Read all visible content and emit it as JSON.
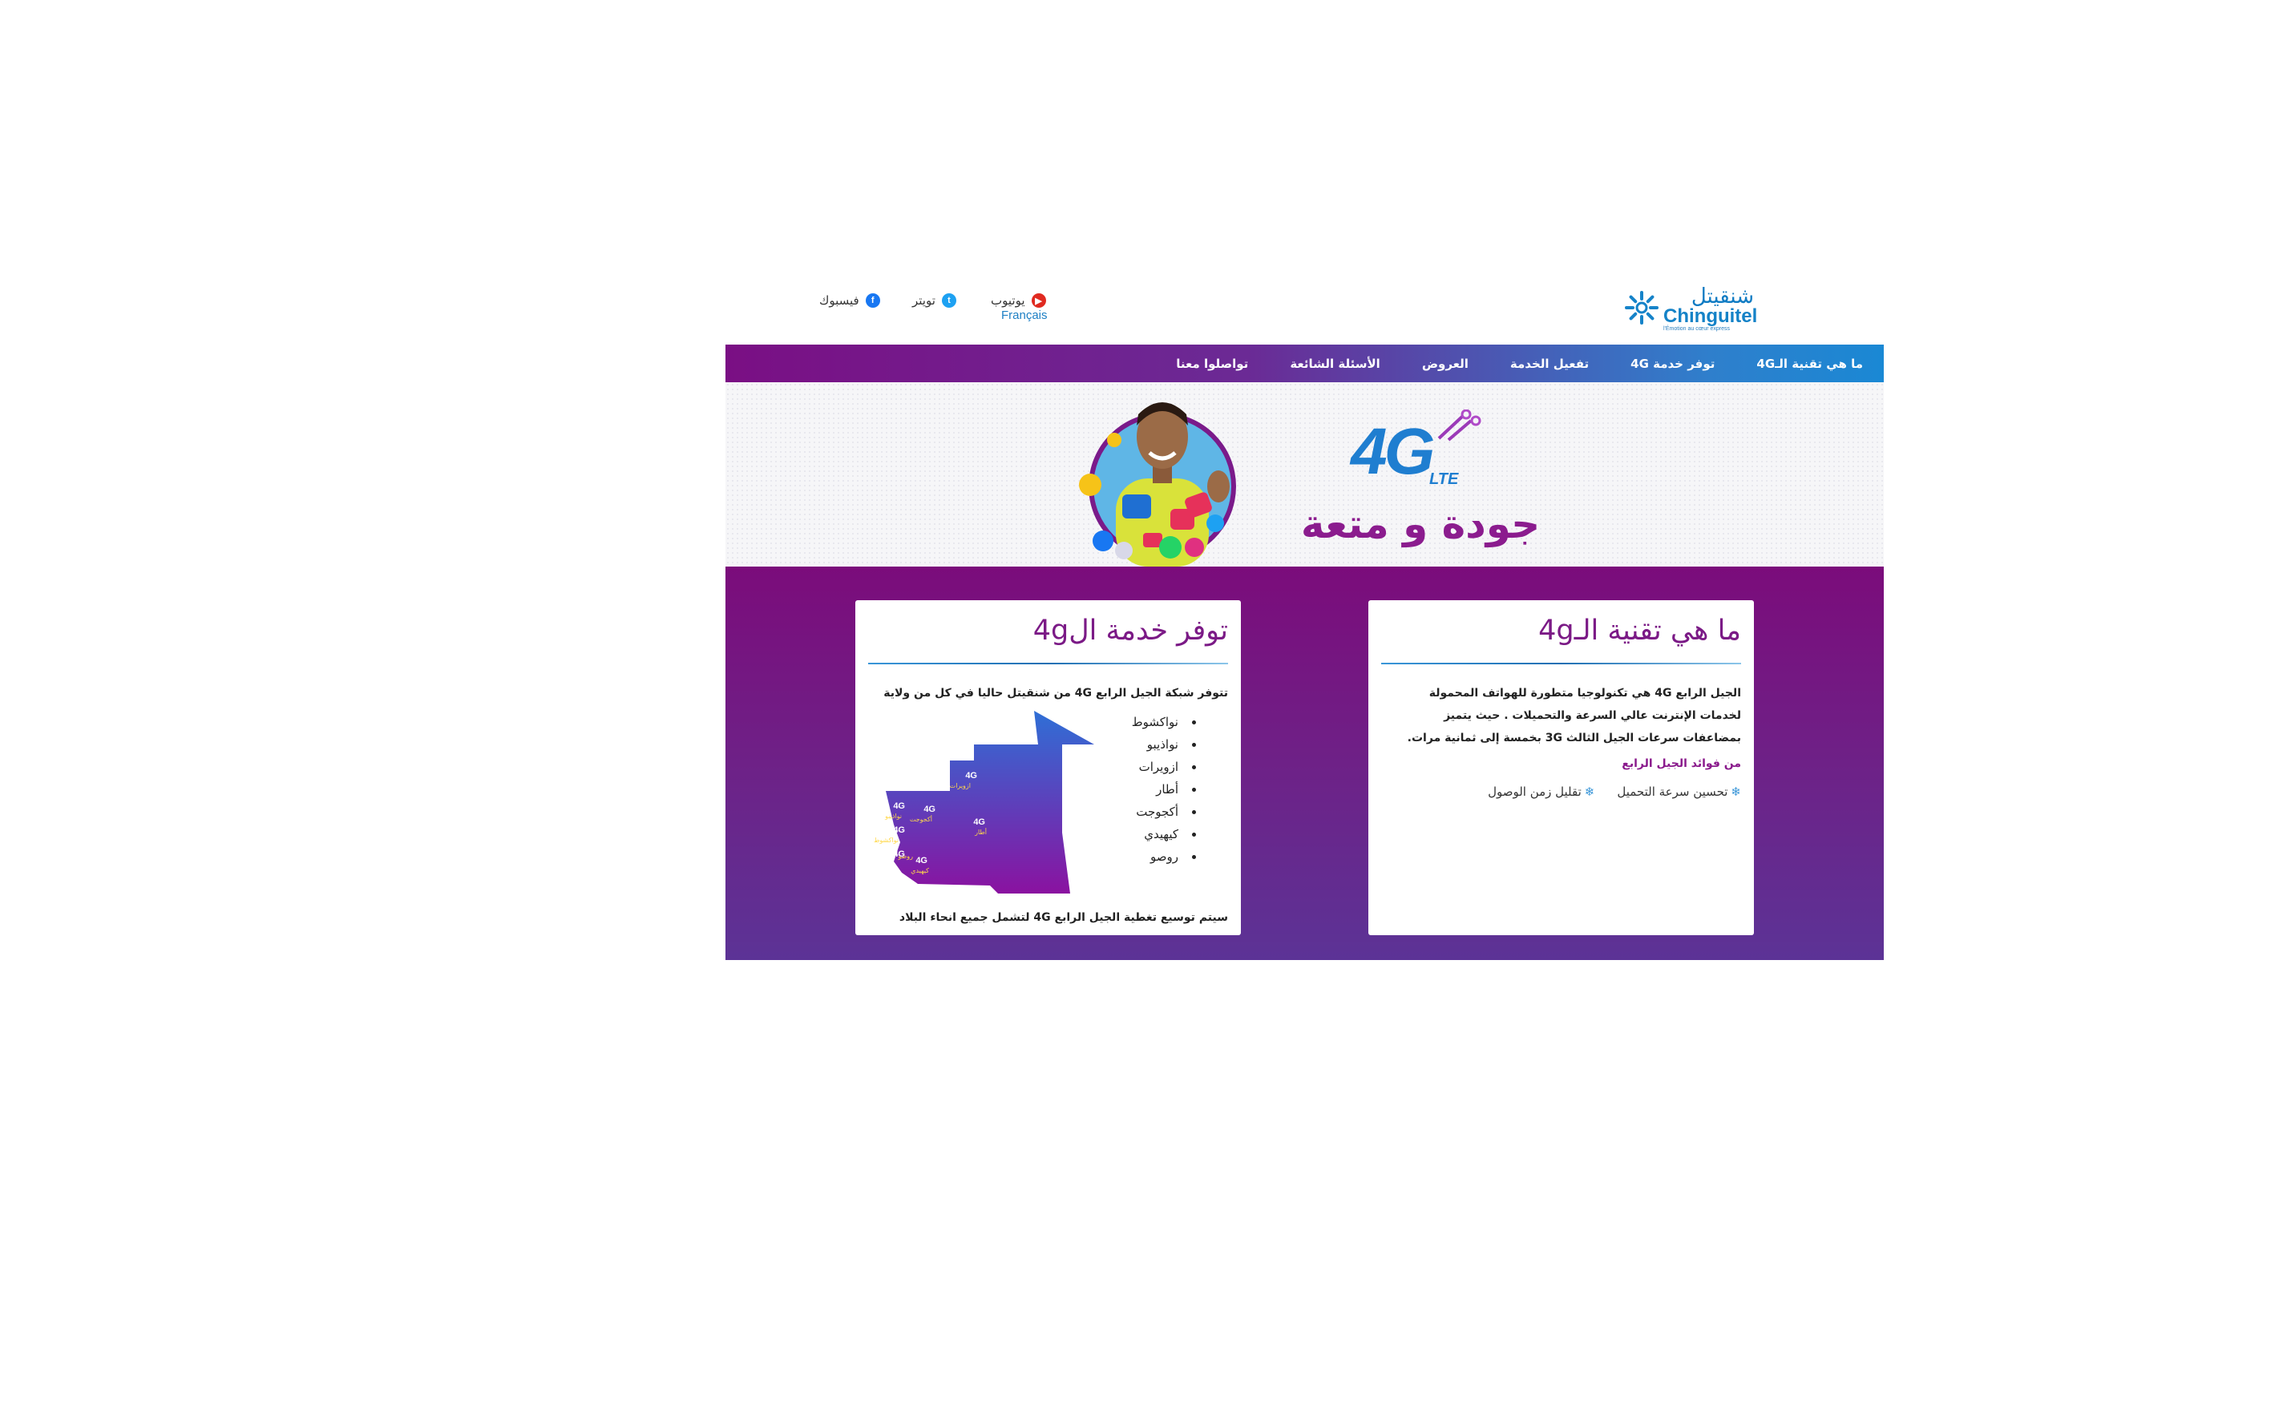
{
  "brand": {
    "name_ar": "شنقيتل",
    "name_en": "Chinguitel",
    "tagline": "l'Émotion au cœur express"
  },
  "social": [
    {
      "label": "يوتيوب",
      "icon": "youtube-icon",
      "color": "#e02a20"
    },
    {
      "label": "تويتر",
      "icon": "twitter-icon",
      "color": "#1da1f2"
    },
    {
      "label": "فيسبوك",
      "icon": "facebook-icon",
      "color": "#1877f2"
    }
  ],
  "language_link": "Français",
  "nav": {
    "items": [
      {
        "label": "ما هي تقنية الـ4G"
      },
      {
        "label": "توفر خدمة 4G"
      },
      {
        "label": "تفعيل الخدمة"
      },
      {
        "label": "العروض"
      },
      {
        "label": "الأسئلة الشائعة"
      },
      {
        "label": "تواصلوا معنا"
      }
    ]
  },
  "hero": {
    "badge_main": "4G",
    "badge_sub": "LTE",
    "slogan": "جودة و متعة"
  },
  "card_tech": {
    "title": "ما هي تقنية الـ4g",
    "line1": "الجيل الرابع 4G هي تكنولوجيا متطورة للهواتف المحمولة",
    "line2": "لخدمات الإنترنت عالي السرعة والتحميلات . حيث يتميز",
    "line3": "بمضاعفات سرعات الجيل الثالث 3G بخمسة إلى ثمانية مرات.",
    "benefits_title": "من فوائد الجيل الرابع",
    "benefits": [
      "تحسين سرعة التحميل",
      "تقليل زمن الوصول"
    ]
  },
  "card_coverage": {
    "title": "توفر خدمة ال4g",
    "intro": "تتوفر شبكة الجيل الرابع 4G من شنقيتل حاليا في كل من ولاية",
    "cities": [
      "نواكشوط",
      "نواذيبو",
      "ازويرات",
      "أطار",
      "أكجوجت",
      "كيهيدي",
      "روصو"
    ],
    "map_labels": [
      "ازويرات",
      "أطار",
      "نواذيبو",
      "أكجوجت",
      "نواكشوط",
      "كيهيدي",
      "روصو"
    ],
    "map_badge": "4G",
    "footer": "سيتم توسيع تغطية الجيل الرابع 4G لتشمل جميع انحاء البلاد"
  },
  "colors": {
    "purple": "#7b0c7b",
    "blue": "#1a88d4",
    "title_purple": "#7b1a86"
  }
}
